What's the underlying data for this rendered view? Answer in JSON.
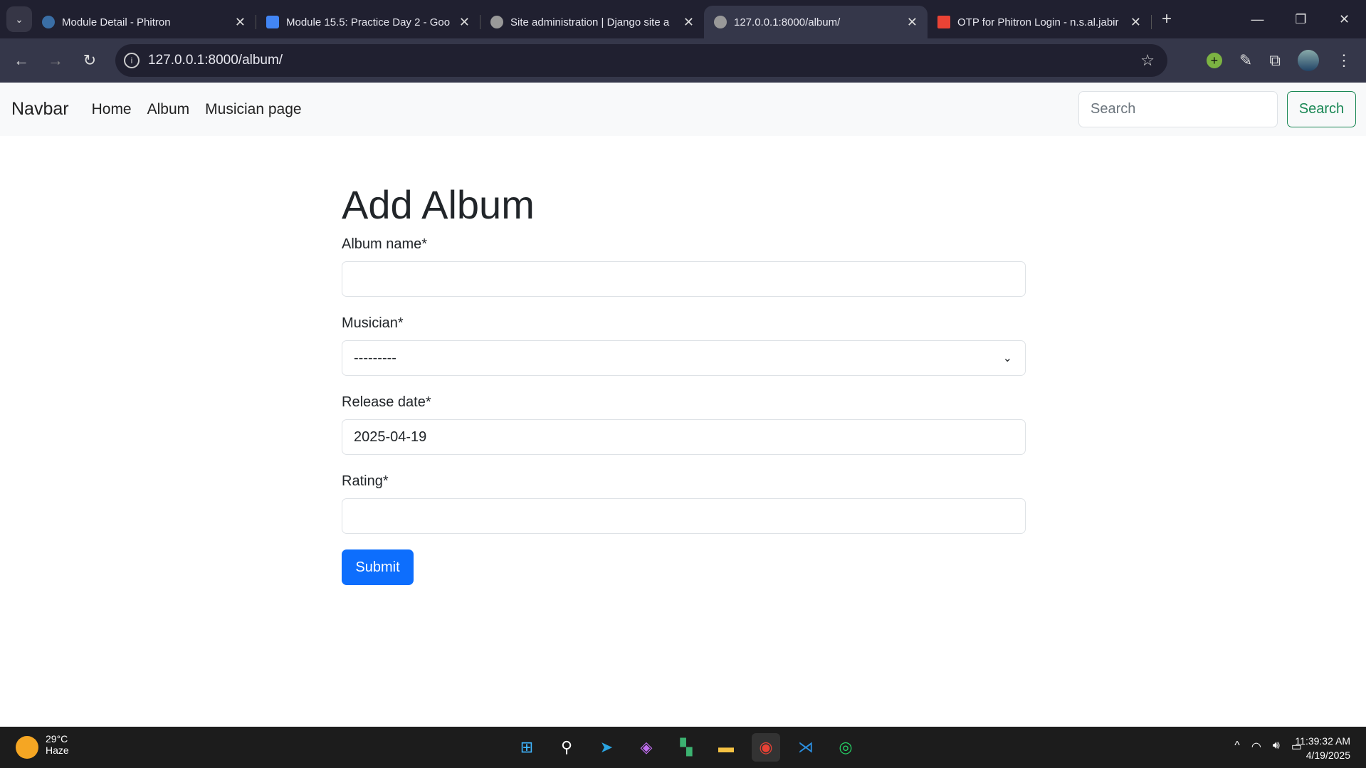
{
  "browser": {
    "tabs": [
      {
        "title": "Module Detail - Phitron",
        "active": false
      },
      {
        "title": "Module 15.5: Practice Day 2 - Goo",
        "active": false
      },
      {
        "title": "Site administration | Django site a",
        "active": false
      },
      {
        "title": "127.0.0.1:8000/album/",
        "active": true
      },
      {
        "title": "OTP for Phitron Login - n.s.al.jabir",
        "active": false
      }
    ],
    "url": "127.0.0.1:8000/album/"
  },
  "navbar": {
    "brand": "Navbar",
    "links": [
      "Home",
      "Album",
      "Musician page"
    ],
    "search_placeholder": "Search",
    "search_button": "Search"
  },
  "form": {
    "title": "Add Album",
    "album_name_label": "Album name*",
    "album_name_value": "",
    "musician_label": "Musician*",
    "musician_value": "---------",
    "release_date_label": "Release date*",
    "release_date_value": "2025-04-19",
    "rating_label": "Rating*",
    "rating_value": "",
    "submit": "Submit"
  },
  "taskbar": {
    "temp": "29°C",
    "weather": "Haze",
    "time": "11:39:32 AM",
    "date": "4/19/2025"
  }
}
